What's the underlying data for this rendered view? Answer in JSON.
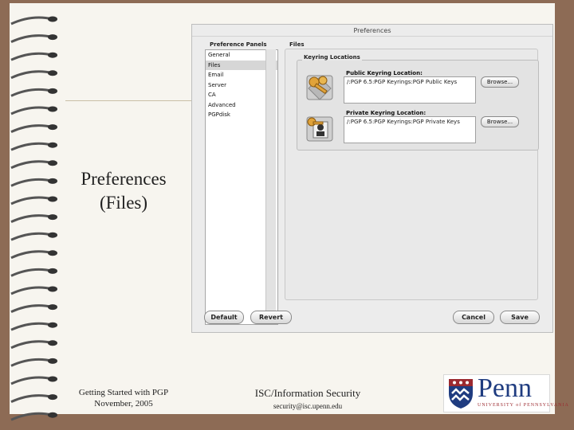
{
  "dialog": {
    "title": "Preferences",
    "panels_header": "Preference Panels",
    "section_header": "Files",
    "panels": [
      "General",
      "Files",
      "Email",
      "Server",
      "CA",
      "Advanced",
      "PGPdisk"
    ],
    "selected_panel": "Files",
    "group_title": "Keyring Locations",
    "public_label": "Public Keyring Location:",
    "public_value": "/:PGP 6.5:PGP Keyrings:PGP Public Keys",
    "private_label": "Private Keyring Location:",
    "private_value": "/:PGP 6.5:PGP Keyrings:PGP Private Keys",
    "browse_label": "Browse...",
    "buttons": {
      "default": "Default",
      "revert": "Revert",
      "cancel": "Cancel",
      "save": "Save"
    }
  },
  "slide": {
    "title_line1": "Preferences",
    "title_line2": "(Files)",
    "footer_left_line1": "Getting Started with PGP",
    "footer_left_line2": "November, 2005",
    "footer_org": "ISC/Information Security",
    "footer_email": "security@isc.upenn.edu",
    "logo_word": "Penn",
    "logo_sub": "UNIVERSITY of PENNSYLVANIA"
  },
  "colors": {
    "background": "#8d6b55",
    "page": "#f7f5ef",
    "penn_blue": "#1f3c80",
    "penn_red": "#9c2a30"
  },
  "icons": [
    "spiral-binding-icon",
    "public-key-icon",
    "private-key-icon",
    "penn-shield-icon"
  ]
}
